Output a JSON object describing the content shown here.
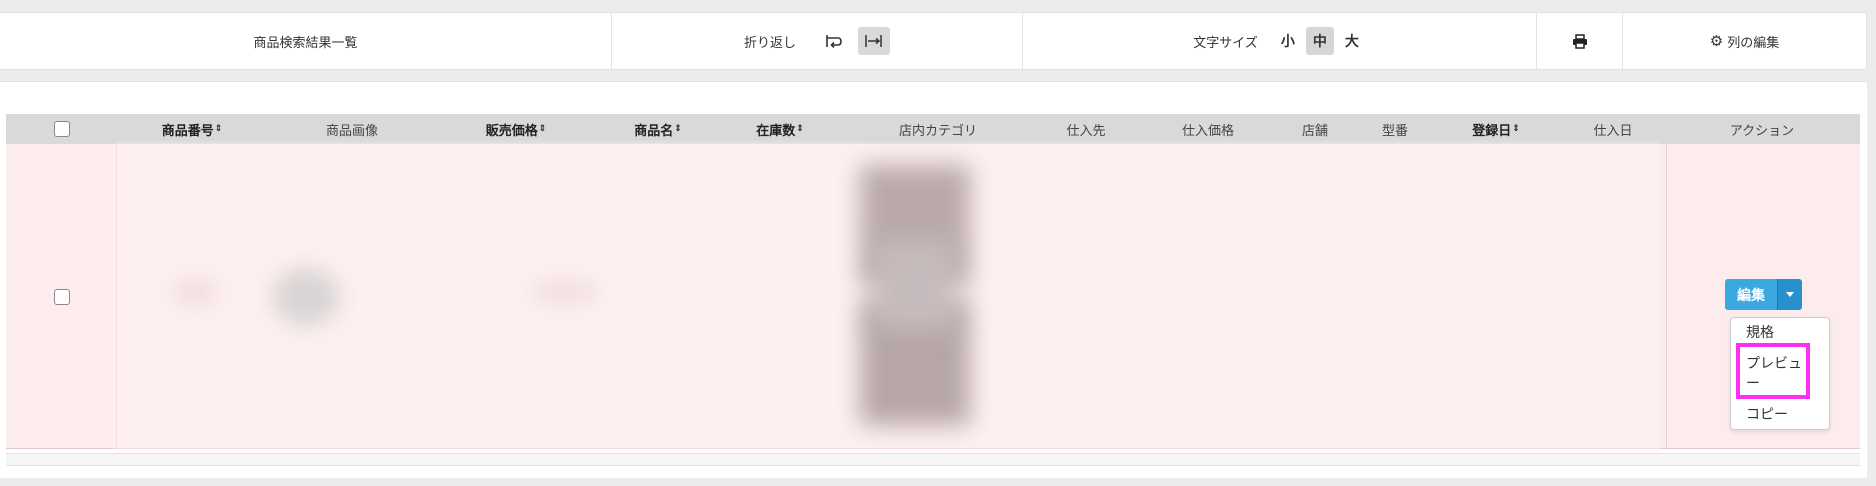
{
  "toolbar": {
    "title": "商品検索結果一覧",
    "wrap_label": "折り返し",
    "text_size_label": "文字サイズ",
    "size_small": "小",
    "size_medium": "中",
    "size_large": "大",
    "edit_columns_label": "列の編集"
  },
  "table": {
    "columns": [
      {
        "label": "商品番号",
        "sortable": true
      },
      {
        "label": "商品画像",
        "sortable": false
      },
      {
        "label": "販売価格",
        "sortable": true
      },
      {
        "label": "商品名",
        "sortable": true
      },
      {
        "label": "在庫数",
        "sortable": true
      },
      {
        "label": "店内カテゴリ",
        "sortable": false
      },
      {
        "label": "仕入先",
        "sortable": false
      },
      {
        "label": "仕入価格",
        "sortable": false
      },
      {
        "label": "店舗",
        "sortable": false
      },
      {
        "label": "型番",
        "sortable": false
      },
      {
        "label": "登録日",
        "sortable": true
      },
      {
        "label": "仕入日",
        "sortable": false
      },
      {
        "label": "アクション",
        "sortable": false
      }
    ],
    "sort_glyph": "⇕"
  },
  "actions": {
    "edit_label": "編集",
    "menu": [
      "規格",
      "プレビュー",
      "コピー"
    ],
    "preview_line1": "プレビュ",
    "preview_line2": "ー"
  },
  "colors": {
    "row_highlight": "#fdeced",
    "edit_button": "#3ba8e0",
    "annotation_box": "#ff2ef5"
  }
}
